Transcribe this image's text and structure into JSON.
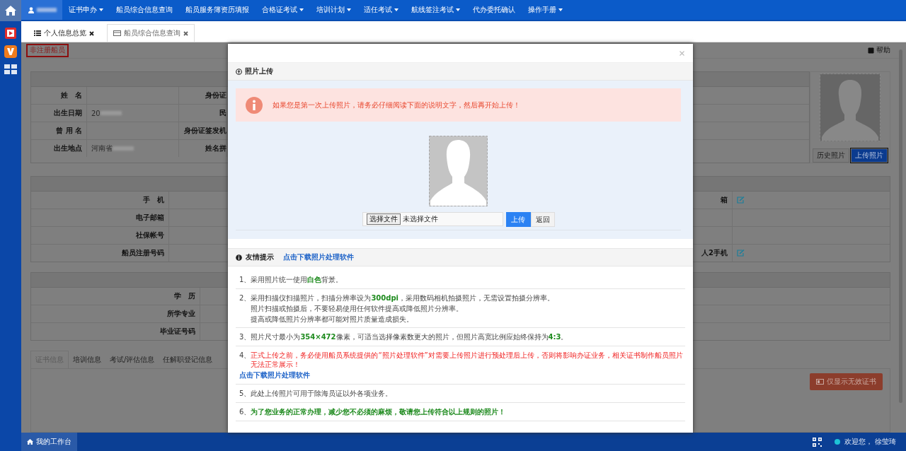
{
  "nav": {
    "items": [
      {
        "label": "证书申办",
        "dropdown": true
      },
      {
        "label": "船员综合信息查询",
        "dropdown": false
      },
      {
        "label": "船员服务簿资历填报",
        "dropdown": false
      },
      {
        "label": "合格证考试",
        "dropdown": true
      },
      {
        "label": "培训计划",
        "dropdown": true
      },
      {
        "label": "适任考试",
        "dropdown": true
      },
      {
        "label": "航线签注考试",
        "dropdown": true
      },
      {
        "label": "代办委托确认",
        "dropdown": false
      },
      {
        "label": "操作手册",
        "dropdown": true
      }
    ]
  },
  "tabs": [
    {
      "label": "个人信息总览",
      "kind": "list",
      "selected": false
    },
    {
      "label": "船员综合信息查询",
      "kind": "card",
      "selected": true
    }
  ],
  "page": {
    "badge": "非注册船员",
    "help": "帮助",
    "basic_rows": [
      {
        "label": "姓　名",
        "label_2": "身份证"
      },
      {
        "label": "出生日期",
        "value": "20",
        "label_2": "民"
      },
      {
        "label": "曾 用 名",
        "label_2": "身份证签发机"
      },
      {
        "label": "出生地点",
        "value": "河南省",
        "label_2": "姓名拼"
      }
    ],
    "photo_buttons": [
      {
        "label": "历史照片",
        "primary": false
      },
      {
        "label": "上传照片",
        "primary": true
      }
    ],
    "contact_rows": [
      {
        "label": "手　机",
        "right_label": "箱",
        "editable": true
      },
      {
        "label": "电子邮箱",
        "editable": false
      },
      {
        "label": "社保帐号",
        "editable": false
      },
      {
        "label": "船员注册号码",
        "right_label": "人2手机",
        "editable": true
      }
    ],
    "education_rows": [
      "学　历",
      "所学专业",
      "毕业证号码"
    ],
    "detail_tabs": [
      {
        "label": "证书信息",
        "selected": true
      },
      {
        "label": "培训信息",
        "selected": false
      },
      {
        "label": "考试/评估信息",
        "selected": false
      },
      {
        "label": "任解职登记信息",
        "selected": false
      }
    ],
    "invalid_button": "仅显示无效证书"
  },
  "modal": {
    "title": "照片上传",
    "alert": "如果您是第一次上传照片，请务必仔细阅读下面的说明文字，然后再开始上传！",
    "file_button": "选择文件",
    "file_status": "未选择文件",
    "upload": "上传",
    "back": "返回",
    "tips_title": "友情提示",
    "tips_link": "点击下载照片处理软件",
    "tips": [
      {
        "number": "1、",
        "kind": "normal",
        "lines": [
          "采用照片统一使用**白色**背景。"
        ]
      },
      {
        "number": "2、",
        "kind": "normal",
        "lines": [
          "采用扫描仪扫描照片，扫描分辨率设为**300dpi**，采用数码相机拍摄照片，无需设置拍摄分辨率。",
          "照片扫描或拍摄后，不要轻易使用任何软件提高或降低照片分辨率。",
          "提高或降低照片分辨率都可能对照片质量造成损失。"
        ]
      },
      {
        "number": "3、",
        "kind": "normal",
        "lines": [
          "照片尺寸最小为**354×472**像素，可适当选择像素数更大的照片，但照片高宽比例应始终保持为**4:3**。"
        ]
      },
      {
        "number": "4、",
        "kind": "warning",
        "lines": [
          "正式上传之前，务必使用船员系统提供的“照片处理软件”对需要上传照片进行预处理后上传，否则将影响办证业务，相关证书制作船员照片无法正常展示！"
        ],
        "link": "点击下载照片处理软件"
      },
      {
        "number": "5、",
        "kind": "normal",
        "lines": [
          "此处上传照片可用于除海员证以外各项业务。"
        ]
      },
      {
        "number": "6、",
        "kind": "emphasis",
        "lines": [
          "为了您业务的正常办理，减少您不必须的麻烦，敬请您上传符合以上规则的照片！"
        ]
      }
    ]
  },
  "bottom": {
    "workspace": "我的工作台",
    "welcome": "欢迎您， 徐莹琦"
  }
}
